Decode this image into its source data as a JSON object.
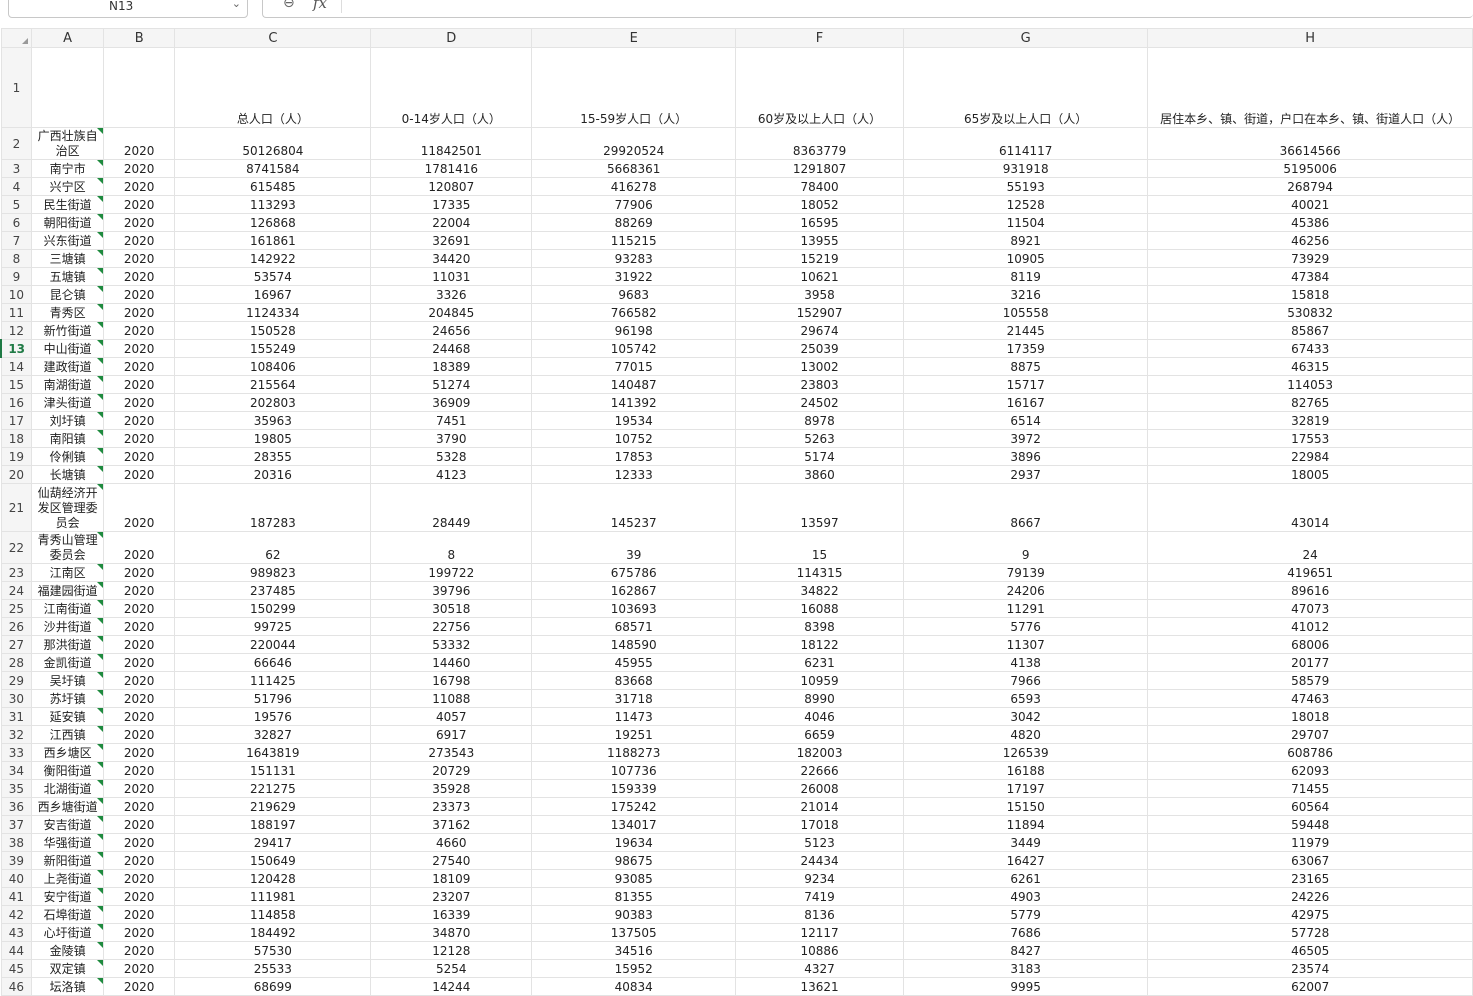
{
  "name_box": "N13",
  "columns": [
    "A",
    "B",
    "C",
    "D",
    "E",
    "F",
    "G",
    "H"
  ],
  "header_row": {
    "num": "1",
    "cells": [
      "",
      "",
      "总人口（人）",
      "0-14岁人口（人）",
      "15-59岁人口（人）",
      "60岁及以上人口（人）",
      "65岁及以上人口（人）",
      "居住本乡、镇、街道，户口在本乡、镇、街道人口（人）"
    ]
  },
  "rows": [
    {
      "num": "2",
      "cells": [
        "广西壮族自治区",
        "2020",
        "50126804",
        "11842501",
        "29920524",
        "8363779",
        "6114117",
        "36614566"
      ]
    },
    {
      "num": "3",
      "cells": [
        "南宁市",
        "2020",
        "8741584",
        "1781416",
        "5668361",
        "1291807",
        "931918",
        "5195006"
      ]
    },
    {
      "num": "4",
      "cells": [
        "兴宁区",
        "2020",
        "615485",
        "120807",
        "416278",
        "78400",
        "55193",
        "268794"
      ]
    },
    {
      "num": "5",
      "cells": [
        "民生街道",
        "2020",
        "113293",
        "17335",
        "77906",
        "18052",
        "12528",
        "40021"
      ]
    },
    {
      "num": "6",
      "cells": [
        "朝阳街道",
        "2020",
        "126868",
        "22004",
        "88269",
        "16595",
        "11504",
        "45386"
      ]
    },
    {
      "num": "7",
      "cells": [
        "兴东街道",
        "2020",
        "161861",
        "32691",
        "115215",
        "13955",
        "8921",
        "46256"
      ]
    },
    {
      "num": "8",
      "cells": [
        "三塘镇",
        "2020",
        "142922",
        "34420",
        "93283",
        "15219",
        "10905",
        "73929"
      ]
    },
    {
      "num": "9",
      "cells": [
        "五塘镇",
        "2020",
        "53574",
        "11031",
        "31922",
        "10621",
        "8119",
        "47384"
      ]
    },
    {
      "num": "10",
      "cells": [
        "昆仑镇",
        "2020",
        "16967",
        "3326",
        "9683",
        "3958",
        "3216",
        "15818"
      ]
    },
    {
      "num": "11",
      "cells": [
        "青秀区",
        "2020",
        "1124334",
        "204845",
        "766582",
        "152907",
        "105558",
        "530832"
      ]
    },
    {
      "num": "12",
      "cells": [
        "新竹街道",
        "2020",
        "150528",
        "24656",
        "96198",
        "29674",
        "21445",
        "85867"
      ]
    },
    {
      "num": "13",
      "cells": [
        "中山街道",
        "2020",
        "155249",
        "24468",
        "105742",
        "25039",
        "17359",
        "67433"
      ]
    },
    {
      "num": "14",
      "cells": [
        "建政街道",
        "2020",
        "108406",
        "18389",
        "77015",
        "13002",
        "8875",
        "46315"
      ]
    },
    {
      "num": "15",
      "cells": [
        "南湖街道",
        "2020",
        "215564",
        "51274",
        "140487",
        "23803",
        "15717",
        "114053"
      ]
    },
    {
      "num": "16",
      "cells": [
        "津头街道",
        "2020",
        "202803",
        "36909",
        "141392",
        "24502",
        "16167",
        "82765"
      ]
    },
    {
      "num": "17",
      "cells": [
        "刘圩镇",
        "2020",
        "35963",
        "7451",
        "19534",
        "8978",
        "6514",
        "32819"
      ]
    },
    {
      "num": "18",
      "cells": [
        "南阳镇",
        "2020",
        "19805",
        "3790",
        "10752",
        "5263",
        "3972",
        "17553"
      ]
    },
    {
      "num": "19",
      "cells": [
        "伶俐镇",
        "2020",
        "28355",
        "5328",
        "17853",
        "5174",
        "3896",
        "22984"
      ]
    },
    {
      "num": "20",
      "cells": [
        "长塘镇",
        "2020",
        "20316",
        "4123",
        "12333",
        "3860",
        "2937",
        "18005"
      ]
    },
    {
      "num": "21",
      "cells": [
        "仙葫经济开发区管理委员会",
        "2020",
        "187283",
        "28449",
        "145237",
        "13597",
        "8667",
        "43014"
      ]
    },
    {
      "num": "22",
      "cells": [
        "青秀山管理委员会",
        "2020",
        "62",
        "8",
        "39",
        "15",
        "9",
        "24"
      ]
    },
    {
      "num": "23",
      "cells": [
        "江南区",
        "2020",
        "989823",
        "199722",
        "675786",
        "114315",
        "79139",
        "419651"
      ]
    },
    {
      "num": "24",
      "cells": [
        "福建园街道",
        "2020",
        "237485",
        "39796",
        "162867",
        "34822",
        "24206",
        "89616"
      ]
    },
    {
      "num": "25",
      "cells": [
        "江南街道",
        "2020",
        "150299",
        "30518",
        "103693",
        "16088",
        "11291",
        "47073"
      ]
    },
    {
      "num": "26",
      "cells": [
        "沙井街道",
        "2020",
        "99725",
        "22756",
        "68571",
        "8398",
        "5776",
        "41012"
      ]
    },
    {
      "num": "27",
      "cells": [
        "那洪街道",
        "2020",
        "220044",
        "53332",
        "148590",
        "18122",
        "11307",
        "68006"
      ]
    },
    {
      "num": "28",
      "cells": [
        "金凯街道",
        "2020",
        "66646",
        "14460",
        "45955",
        "6231",
        "4138",
        "20177"
      ]
    },
    {
      "num": "29",
      "cells": [
        "吴圩镇",
        "2020",
        "111425",
        "16798",
        "83668",
        "10959",
        "7966",
        "58579"
      ]
    },
    {
      "num": "30",
      "cells": [
        "苏圩镇",
        "2020",
        "51796",
        "11088",
        "31718",
        "8990",
        "6593",
        "47463"
      ]
    },
    {
      "num": "31",
      "cells": [
        "延安镇",
        "2020",
        "19576",
        "4057",
        "11473",
        "4046",
        "3042",
        "18018"
      ]
    },
    {
      "num": "32",
      "cells": [
        "江西镇",
        "2020",
        "32827",
        "6917",
        "19251",
        "6659",
        "4820",
        "29707"
      ]
    },
    {
      "num": "33",
      "cells": [
        "西乡塘区",
        "2020",
        "1643819",
        "273543",
        "1188273",
        "182003",
        "126539",
        "608786"
      ]
    },
    {
      "num": "34",
      "cells": [
        "衡阳街道",
        "2020",
        "151131",
        "20729",
        "107736",
        "22666",
        "16188",
        "62093"
      ]
    },
    {
      "num": "35",
      "cells": [
        "北湖街道",
        "2020",
        "221275",
        "35928",
        "159339",
        "26008",
        "17197",
        "71455"
      ]
    },
    {
      "num": "36",
      "cells": [
        "西乡塘街道",
        "2020",
        "219629",
        "23373",
        "175242",
        "21014",
        "15150",
        "60564"
      ]
    },
    {
      "num": "37",
      "cells": [
        "安吉街道",
        "2020",
        "188197",
        "37162",
        "134017",
        "17018",
        "11894",
        "59448"
      ]
    },
    {
      "num": "38",
      "cells": [
        "华强街道",
        "2020",
        "29417",
        "4660",
        "19634",
        "5123",
        "3449",
        "11979"
      ]
    },
    {
      "num": "39",
      "cells": [
        "新阳街道",
        "2020",
        "150649",
        "27540",
        "98675",
        "24434",
        "16427",
        "63067"
      ]
    },
    {
      "num": "40",
      "cells": [
        "上尧街道",
        "2020",
        "120428",
        "18109",
        "93085",
        "9234",
        "6261",
        "23165"
      ]
    },
    {
      "num": "41",
      "cells": [
        "安宁街道",
        "2020",
        "111981",
        "23207",
        "81355",
        "7419",
        "4903",
        "24226"
      ]
    },
    {
      "num": "42",
      "cells": [
        "石埠街道",
        "2020",
        "114858",
        "16339",
        "90383",
        "8136",
        "5779",
        "42975"
      ]
    },
    {
      "num": "43",
      "cells": [
        "心圩街道",
        "2020",
        "184492",
        "34870",
        "137505",
        "12117",
        "7686",
        "57728"
      ]
    },
    {
      "num": "44",
      "cells": [
        "金陵镇",
        "2020",
        "57530",
        "12128",
        "34516",
        "10886",
        "8427",
        "46505"
      ]
    },
    {
      "num": "45",
      "cells": [
        "双定镇",
        "2020",
        "25533",
        "5254",
        "15952",
        "4327",
        "3183",
        "23574"
      ]
    },
    {
      "num": "46",
      "cells": [
        "坛洛镇",
        "2020",
        "68699",
        "14244",
        "40834",
        "13621",
        "9995",
        "62007"
      ]
    }
  ]
}
